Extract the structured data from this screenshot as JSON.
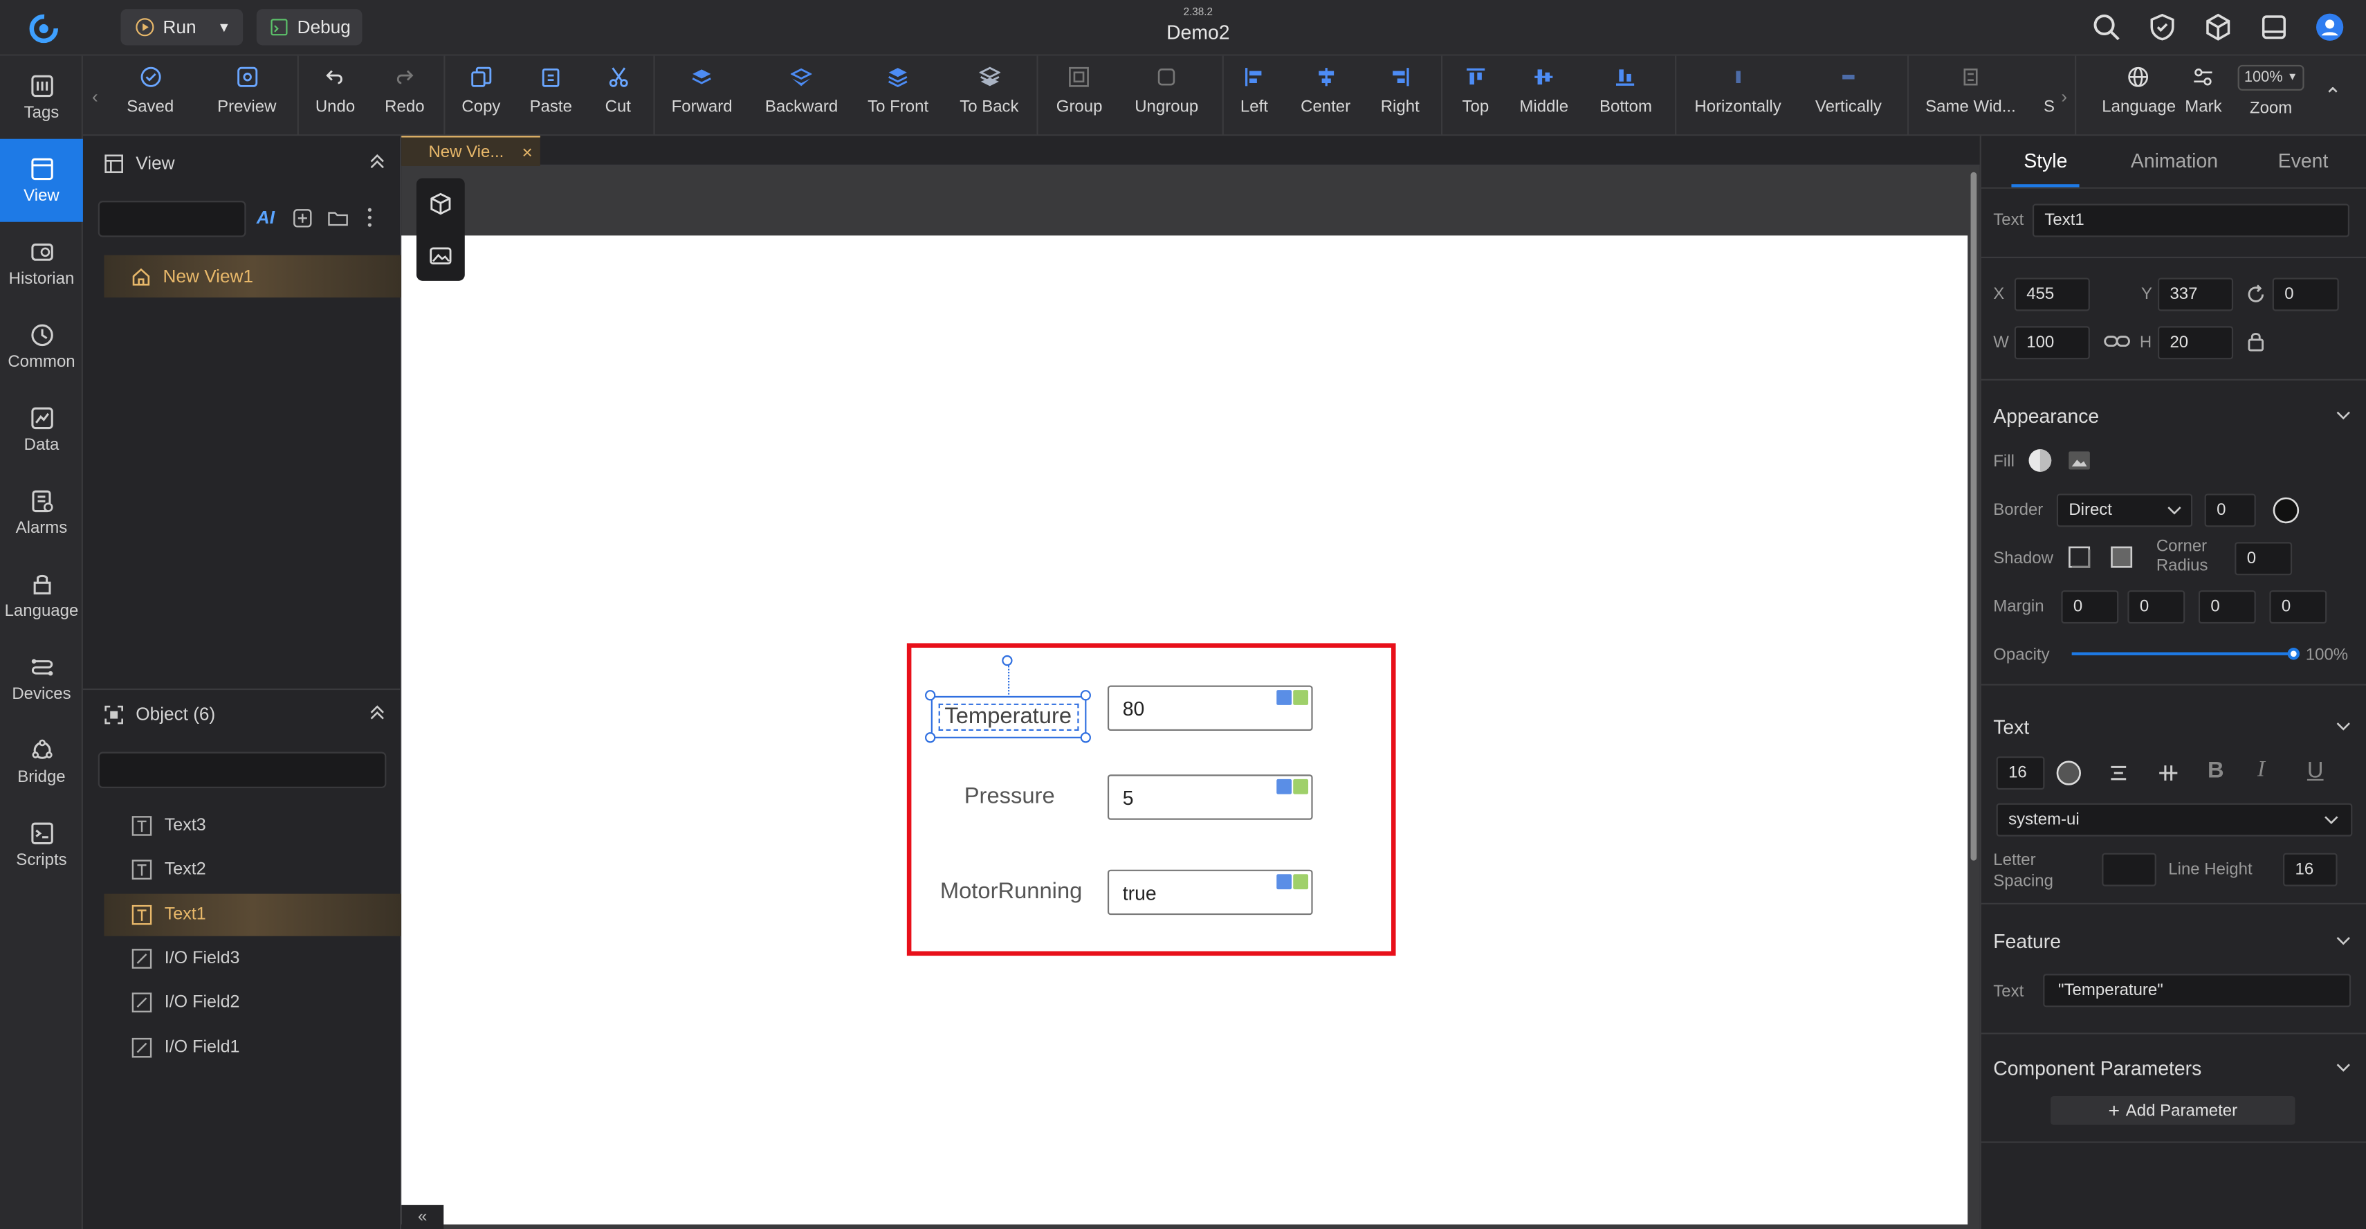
{
  "app": {
    "version": "2.38.2",
    "name": "Demo2"
  },
  "topbar": {
    "run_label": "Run",
    "debug_label": "Debug"
  },
  "rail": [
    {
      "label": "Tags",
      "icon": "tags-icon"
    },
    {
      "label": "View",
      "icon": "view-icon",
      "active": true
    },
    {
      "label": "Historian",
      "icon": "historian-icon"
    },
    {
      "label": "Common",
      "icon": "common-icon"
    },
    {
      "label": "Data",
      "icon": "data-icon"
    },
    {
      "label": "Alarms",
      "icon": "alarms-icon"
    },
    {
      "label": "Language",
      "icon": "language-icon"
    },
    {
      "label": "Devices",
      "icon": "devices-icon"
    },
    {
      "label": "Bridge",
      "icon": "bridge-icon"
    },
    {
      "label": "Scripts",
      "icon": "scripts-icon"
    }
  ],
  "toolbar": {
    "items": [
      "Saved",
      "Preview",
      "Undo",
      "Redo",
      "Copy",
      "Paste",
      "Cut",
      "Forward",
      "Backward",
      "To Front",
      "To Back",
      "Group",
      "Ungroup",
      "Left",
      "Center",
      "Right",
      "Top",
      "Middle",
      "Bottom",
      "Horizontally",
      "Vertically",
      "Same Wid...",
      "S"
    ],
    "right_items": [
      "Language",
      "Mark",
      "Zoom"
    ],
    "zoom_value": "100%"
  },
  "view_panel": {
    "title": "View",
    "ai_label": "AI",
    "tree_item": "New View1",
    "object_title": "Object (6)",
    "objects": [
      "Text3",
      "Text2",
      "Text1",
      "I/O Field3",
      "I/O Field2",
      "I/O Field1"
    ]
  },
  "canvas": {
    "tab_label": "New Vie...",
    "labels": {
      "temperature": "Temperature",
      "pressure": "Pressure",
      "motor": "MotorRunning"
    },
    "fields": {
      "temperature": "80",
      "pressure": "5",
      "motor": "true"
    },
    "collapse_glyph": "«"
  },
  "properties": {
    "tabs": [
      "Style",
      "Animation",
      "Event"
    ],
    "text_label": "Text",
    "text_value": "Text1",
    "x_label": "X",
    "x_value": "455",
    "y_label": "Y",
    "y_value": "337",
    "rotation_value": "0",
    "w_label": "W",
    "w_value": "100",
    "h_label": "H",
    "h_value": "20",
    "appearance": {
      "title": "Appearance",
      "fill_label": "Fill",
      "border_label": "Border",
      "border_value": "Direct",
      "border_width": "0",
      "shadow_label": "Shadow",
      "corner_radius_label": "Corner Radius",
      "corner_radius_value": "0",
      "margin_label": "Margin",
      "margins": [
        "0",
        "0",
        "0",
        "0"
      ],
      "opacity_label": "Opacity",
      "opacity_value": "100%"
    },
    "text_section": {
      "title": "Text",
      "font_size": "16",
      "font_family": "system-ui",
      "letter_spacing_label": "Letter Spacing",
      "line_height_label": "Line Height",
      "line_height_value": "16"
    },
    "feature": {
      "title": "Feature",
      "text_label": "Text",
      "text_value": "\"Temperature\""
    },
    "component_params": {
      "title": "Component Parameters",
      "add_label": "Add Parameter"
    }
  }
}
